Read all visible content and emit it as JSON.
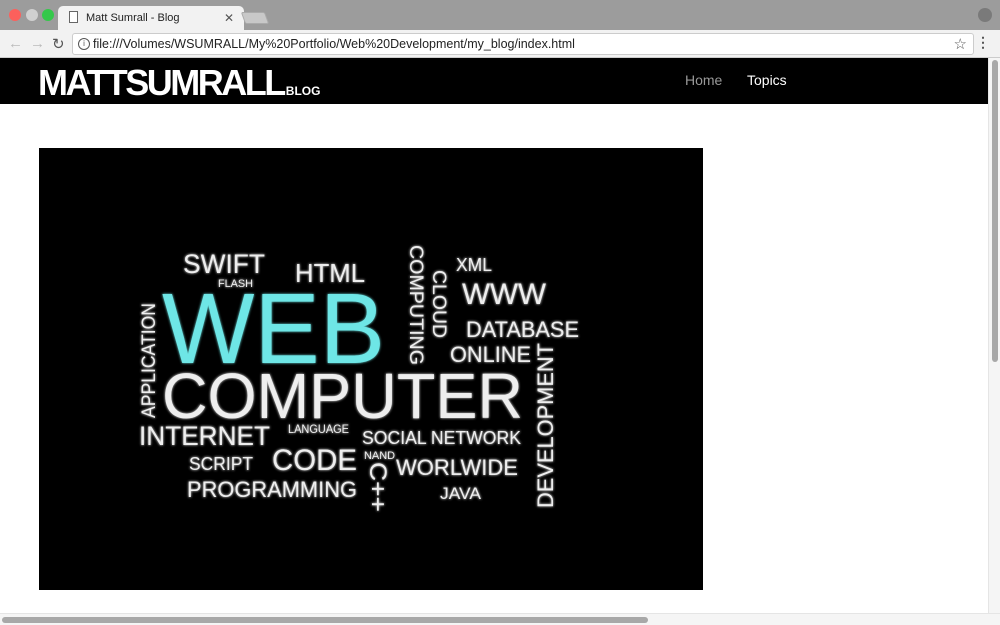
{
  "browser": {
    "tab_title": "Matt Sumrall - Blog",
    "url": "file:///Volumes/WSUMRALL/My%20Portfolio/Web%20Development/my_blog/index.html"
  },
  "site": {
    "logo": "MATTSUMRALL",
    "logo_sub": "BLOG",
    "nav": [
      {
        "label": "Home"
      },
      {
        "label": "Topics"
      }
    ]
  },
  "word_cloud": {
    "highlight_color": "#6ee6e6",
    "words": [
      "WEB",
      "COMPUTER",
      "SWIFT",
      "FLASH",
      "HTML",
      "COMPUTING",
      "CLOUD",
      "XML",
      "WWW",
      "DATABASE",
      "ONLINE",
      "APPLICATION",
      "DEVELOPMENT",
      "INTERNET",
      "LANGUAGE",
      "SOCIAL NETWORK",
      "SCRIPT",
      "CODE",
      "NAND",
      "WORLWIDE",
      "C++",
      "PROGRAMMING",
      "JAVA"
    ]
  }
}
